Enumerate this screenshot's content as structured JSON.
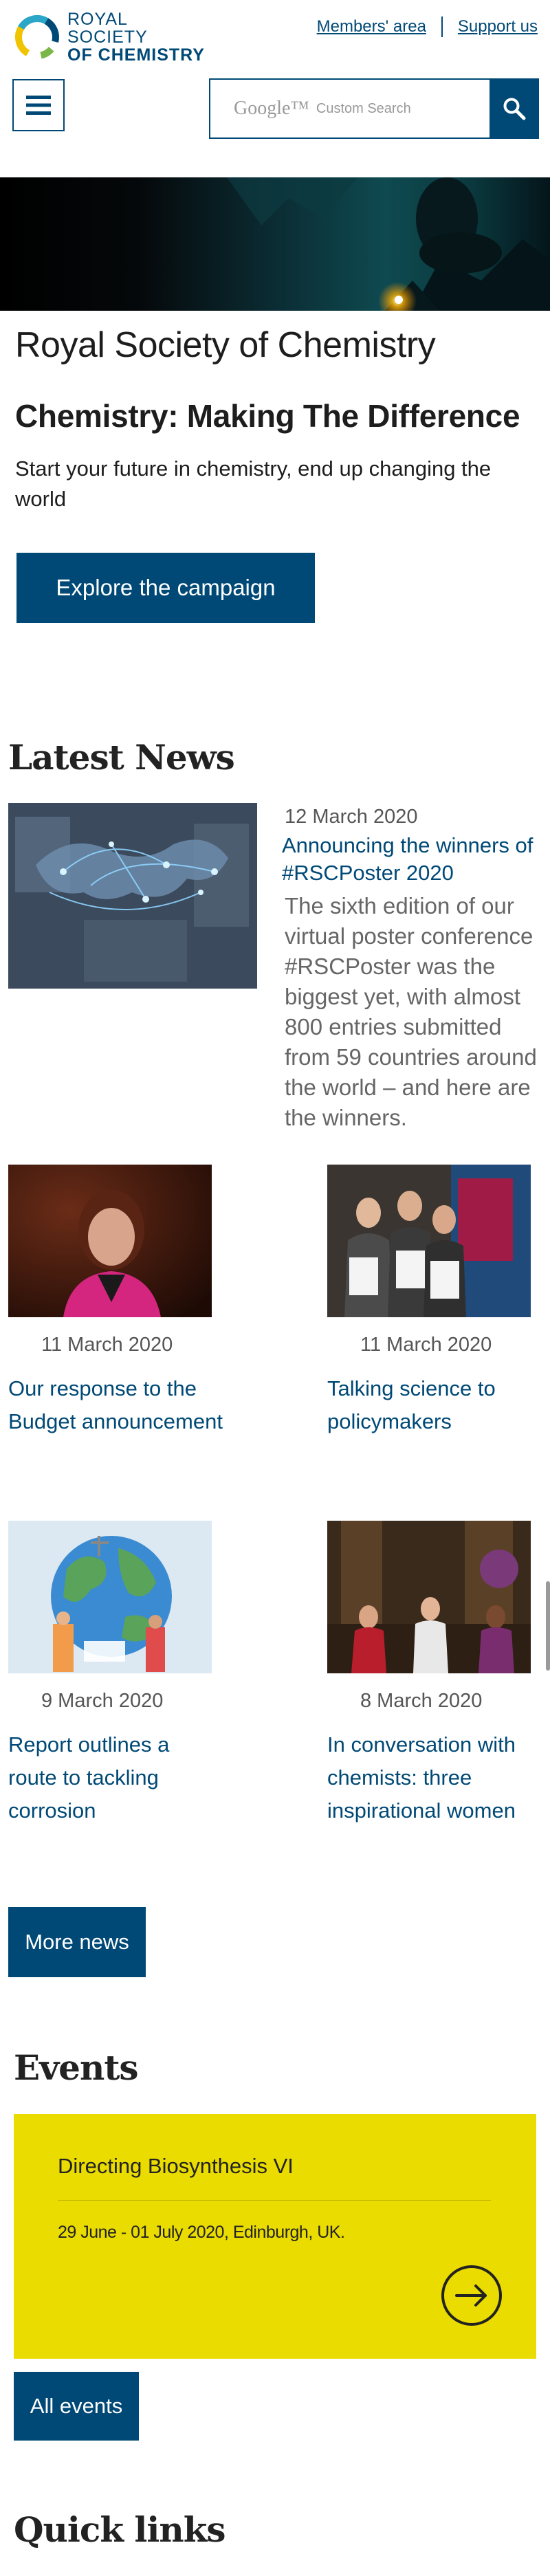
{
  "header": {
    "logo_line1": "ROYAL SOCIETY",
    "logo_line2": "OF CHEMISTRY",
    "members_link": "Members' area",
    "support_link": "Support us",
    "search_brand": "Google™",
    "search_placeholder": "Custom Search",
    "menu_icon": "hamburger-icon",
    "search_icon": "magnifier-icon"
  },
  "hero": {
    "title": "Royal Society of Chemistry",
    "subtitle": "Chemistry: Making The Difference",
    "intro": "Start your future in chemistry, end up changing the world",
    "cta_label": "Explore the campaign"
  },
  "news": {
    "section_title": "Latest News",
    "featured": {
      "date": "12 March 2020",
      "title": "Announcing the winners of #RSCPoster 2020",
      "summary": "The sixth edition of our virtual poster conference #RSCPoster was the biggest yet, with almost 800 entries submitted from 59 countries around the world – and here are the winners."
    },
    "items": [
      {
        "date": "11 March 2020",
        "title": "Our response to the Budget announcement"
      },
      {
        "date": "11 March 2020",
        "title": "Talking science to policymakers"
      },
      {
        "date": "9 March 2020",
        "title": "Report outlines a route to tackling corrosion"
      },
      {
        "date": "8 March 2020",
        "title": "In conversation with chemists: three inspirational women"
      }
    ],
    "more_label": "More news"
  },
  "events": {
    "section_title": "Events",
    "card": {
      "title": "Directing Biosynthesis VI",
      "meta": "29 June - 01 July 2020, Edinburgh, UK.",
      "arrow_icon": "arrow-right-circle-icon"
    },
    "all_label": "All events"
  },
  "quick_links": {
    "section_title": "Quick links"
  },
  "colors": {
    "brand_blue": "#004976",
    "event_yellow": "#ebdc00"
  }
}
